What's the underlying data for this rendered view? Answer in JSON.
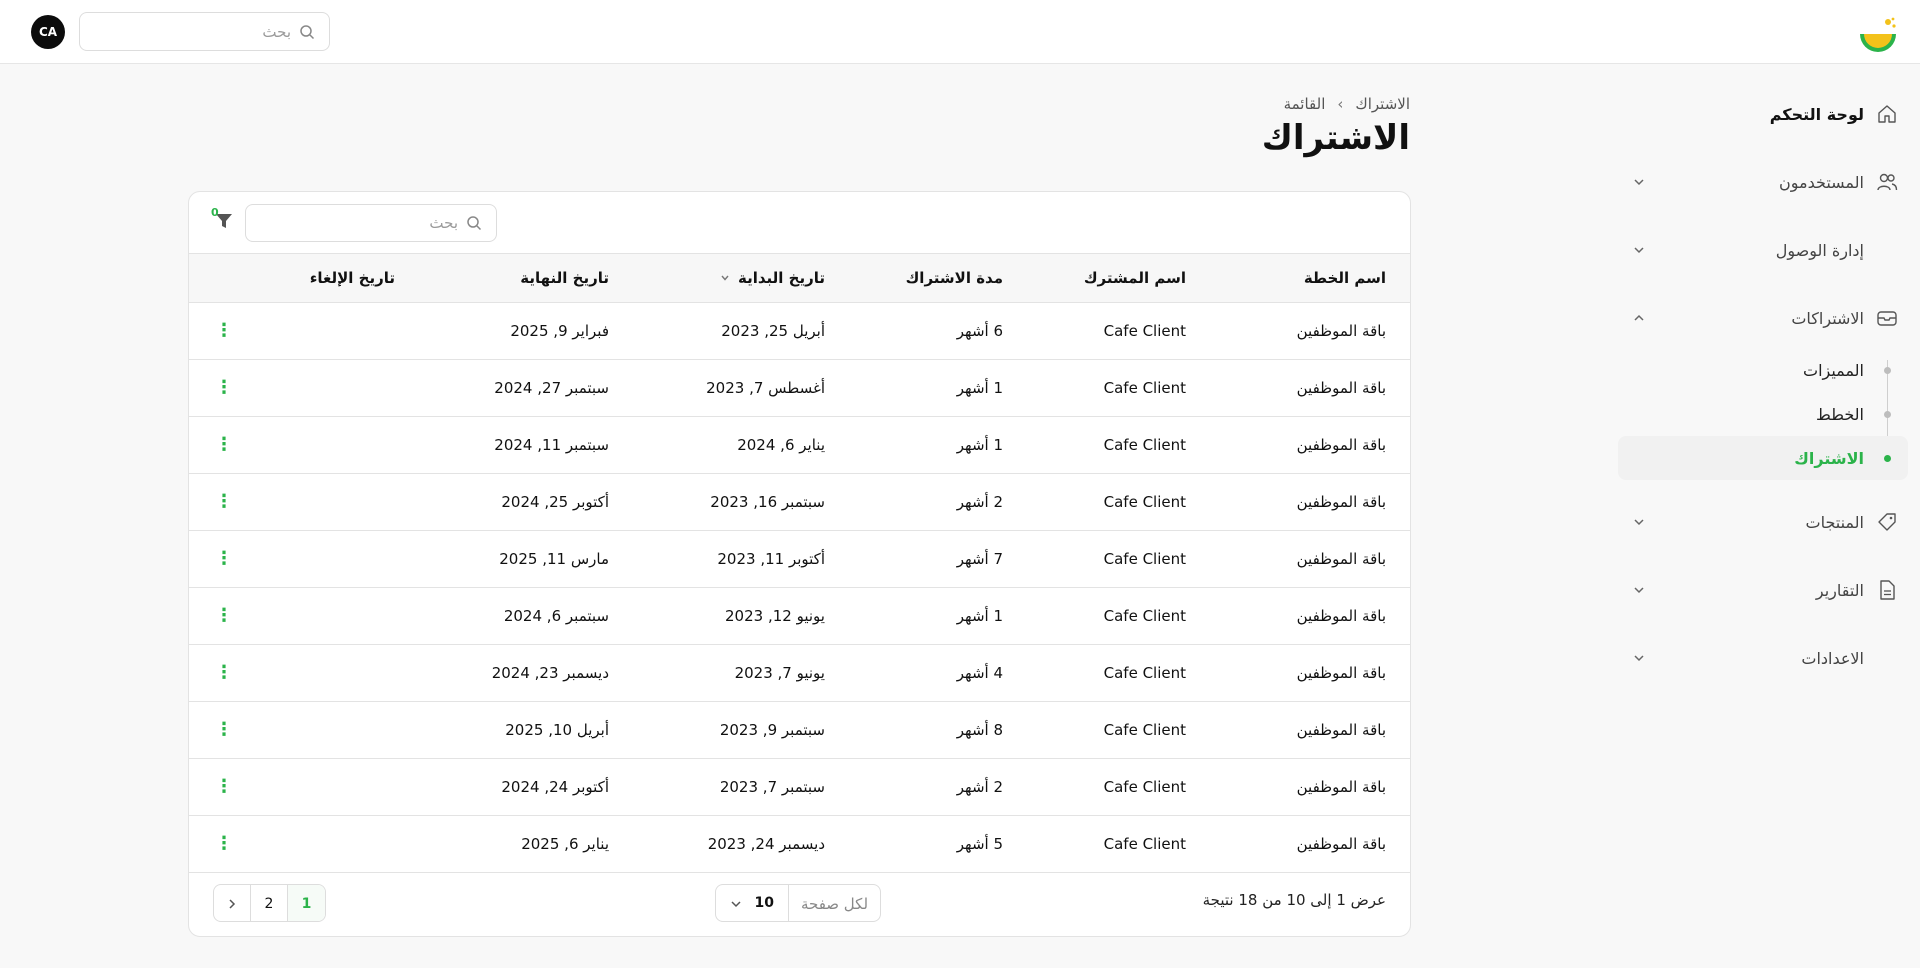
{
  "topbar": {
    "avatar_initials": "CA",
    "search_placeholder": "بحث"
  },
  "sidebar": {
    "items": [
      {
        "label": "لوحة التحكم",
        "icon": "home-icon"
      },
      {
        "label": "المستخدمون",
        "icon": "users-icon"
      },
      {
        "label": "إدارة الوصول",
        "icon": "shield-icon"
      },
      {
        "label": "الاشتراكات",
        "icon": "box-icon"
      },
      {
        "label": "المنتجات",
        "icon": "tag-icon"
      },
      {
        "label": "التقارير",
        "icon": "document-icon"
      },
      {
        "label": "الاعدادات",
        "icon": "gear-icon"
      }
    ],
    "subscriptions_sub": [
      {
        "label": "المميزات"
      },
      {
        "label": "الخطط"
      },
      {
        "label": "الاشتراك"
      }
    ]
  },
  "breadcrumb": {
    "root": "الاشتراك",
    "current": "القائمة"
  },
  "page_title": "الاشتراك",
  "table": {
    "search_placeholder": "بحث",
    "filter_count": "0",
    "columns": [
      "اسم الخطة",
      "اسم المشترك",
      "مدة الاشتراك",
      "تاريخ البداية",
      "تاريخ النهاية",
      "تاريخ الإلغاء"
    ],
    "rows": [
      [
        "باقة الموظفين",
        "Cafe Client",
        "6 أشهر",
        "أبريل 25, 2023",
        "فبراير 9, 2025",
        ""
      ],
      [
        "باقة الموظفين",
        "Cafe Client",
        "1 أشهر",
        "أغسطس 7, 2023",
        "سبتمبر 27, 2024",
        ""
      ],
      [
        "باقة الموظفين",
        "Cafe Client",
        "1 أشهر",
        "يناير 6, 2024",
        "سبتمبر 11, 2024",
        ""
      ],
      [
        "باقة الموظفين",
        "Cafe Client",
        "2 أشهر",
        "سبتمبر 16, 2023",
        "أكتوبر 25, 2024",
        ""
      ],
      [
        "باقة الموظفين",
        "Cafe Client",
        "7 أشهر",
        "أكتوبر 11, 2023",
        "مارس 11, 2025",
        ""
      ],
      [
        "باقة الموظفين",
        "Cafe Client",
        "1 أشهر",
        "يونيو 12, 2023",
        "سبتمبر 6, 2024",
        ""
      ],
      [
        "باقة الموظفين",
        "Cafe Client",
        "4 أشهر",
        "يونيو 7, 2023",
        "ديسمبر 23, 2024",
        ""
      ],
      [
        "باقة الموظفين",
        "Cafe Client",
        "8 أشهر",
        "سبتمبر 9, 2023",
        "أبريل 10, 2025",
        ""
      ],
      [
        "باقة الموظفين",
        "Cafe Client",
        "2 أشهر",
        "سبتمبر 7, 2023",
        "أكتوبر 24, 2024",
        ""
      ],
      [
        "باقة الموظفين",
        "Cafe Client",
        "5 أشهر",
        "ديسمبر 24, 2023",
        "يناير 6, 2025",
        ""
      ]
    ],
    "row_menu_glyph": "⋮"
  },
  "footer": {
    "results_text": "عرض 1 إلى 10 من 18 نتيجة",
    "per_page_label": "لكل صفحة",
    "per_page_value": "10",
    "pages": [
      "1",
      "2"
    ],
    "active_page": "1"
  },
  "colors": {
    "accent": "#2bb34a",
    "text": "#111111",
    "border": "#e3e3e3"
  }
}
